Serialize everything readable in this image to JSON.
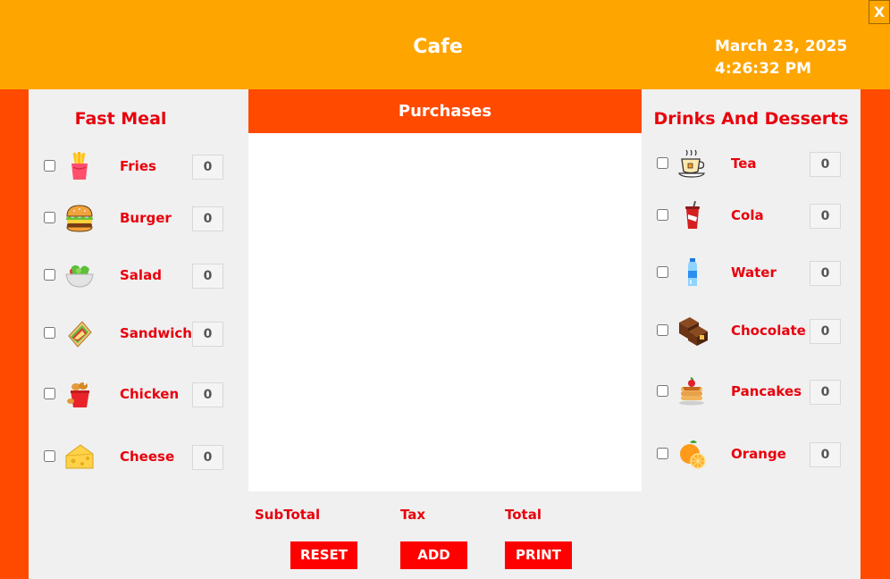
{
  "window": {
    "title": "Cafe",
    "close_label": "X",
    "date": "March 23, 2025",
    "time": "4:26:32 PM"
  },
  "colors": {
    "header_bg": "#ffa500",
    "frame_bg": "#ff4a00",
    "panel_bg": "#f0f0f0",
    "label_red": "#e8000c",
    "button_red": "#ff0000"
  },
  "fast_meal": {
    "title": "Fast Meal",
    "items": [
      {
        "label": "Fries",
        "qty": "0",
        "icon": "fries-icon",
        "checked": false
      },
      {
        "label": "Burger",
        "qty": "0",
        "icon": "burger-icon",
        "checked": false
      },
      {
        "label": "Salad",
        "qty": "0",
        "icon": "salad-icon",
        "checked": false
      },
      {
        "label": "Sandwich",
        "qty": "0",
        "icon": "sandwich-icon",
        "checked": false
      },
      {
        "label": "Chicken",
        "qty": "0",
        "icon": "chicken-bucket-icon",
        "checked": false
      },
      {
        "label": "Cheese",
        "qty": "0",
        "icon": "cheese-icon",
        "checked": false
      }
    ]
  },
  "drinks": {
    "title": "Drinks And Desserts",
    "items": [
      {
        "label": "Tea",
        "qty": "0",
        "icon": "tea-cup-icon",
        "checked": false
      },
      {
        "label": "Cola",
        "qty": "0",
        "icon": "cola-cup-icon",
        "checked": false
      },
      {
        "label": "Water",
        "qty": "0",
        "icon": "water-bottle-icon",
        "checked": false
      },
      {
        "label": "Chocolate",
        "qty": "0",
        "icon": "chocolate-icon",
        "checked": false
      },
      {
        "label": "Pancakes",
        "qty": "0",
        "icon": "pancakes-icon",
        "checked": false
      },
      {
        "label": "Orange",
        "qty": "0",
        "icon": "orange-icon",
        "checked": false
      }
    ]
  },
  "purchases": {
    "title": "Purchases"
  },
  "totals": {
    "subtotal_label": "SubTotal",
    "tax_label": "Tax",
    "total_label": "Total"
  },
  "buttons": {
    "reset": "RESET",
    "add": "ADD",
    "print": "PRINT"
  }
}
